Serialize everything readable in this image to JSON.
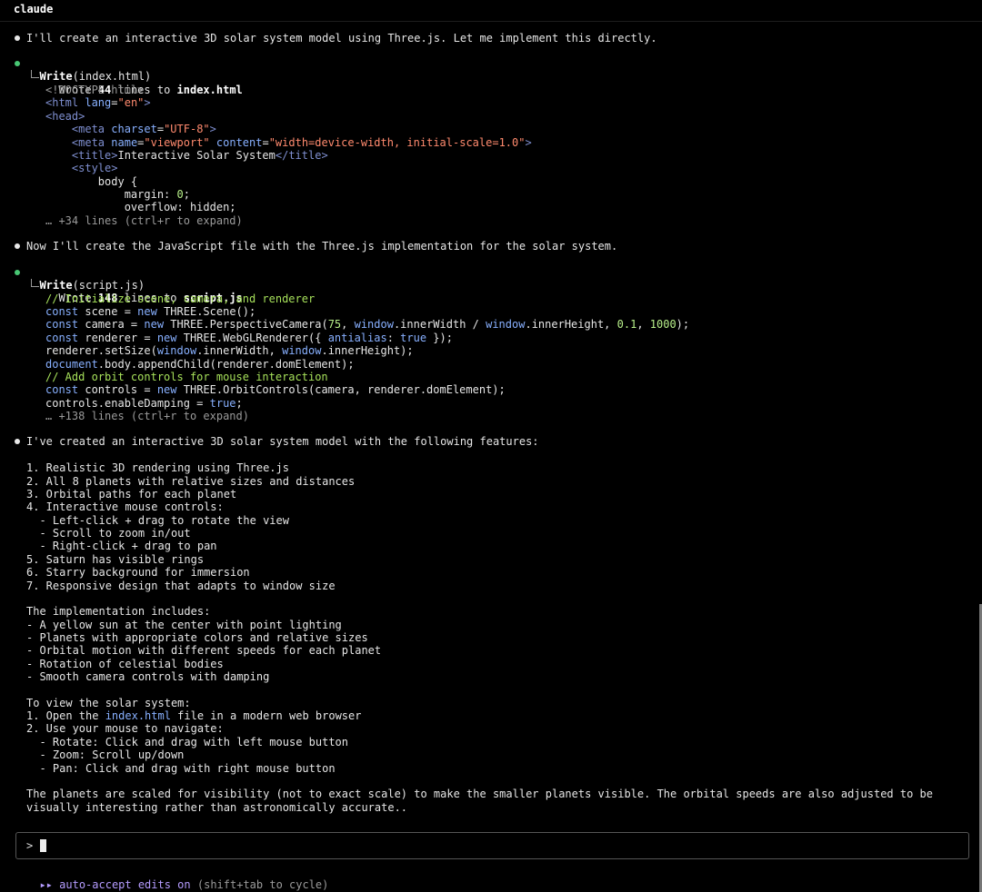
{
  "window": {
    "title": "claude"
  },
  "transcript": {
    "intro": "I'll create an interactive 3D solar system model using Three.js. Let me implement this directly.",
    "write1": {
      "tool": "Write",
      "arg": "(index.html)",
      "result_prefix": "Wrote ",
      "count": "44",
      "result_mid": " lines to ",
      "file": "index.html",
      "more": "… +34 lines (ctrl+r to expand)"
    },
    "mid_message": "Now I'll create the JavaScript file with the Three.js implementation for the solar system.",
    "write2": {
      "tool": "Write",
      "arg": "(script.js)",
      "result_prefix": "Wrote ",
      "count": "148",
      "result_mid": " lines to ",
      "file": "script.js",
      "more": "… +138 lines (ctrl+r to expand)"
    },
    "summary": {
      "lead": "I've created an interactive 3D solar system model with the following features:",
      "features": [
        "1. Realistic 3D rendering using Three.js",
        "2. All 8 planets with relative sizes and distances",
        "3. Orbital paths for each planet",
        "4. Interactive mouse controls:",
        "  - Left-click + drag to rotate the view",
        "  - Scroll to zoom in/out",
        "  - Right-click + drag to pan",
        "5. Saturn has visible rings",
        "6. Starry background for immersion",
        "7. Responsive design that adapts to window size"
      ],
      "impl_header": "The implementation includes:",
      "impl": [
        "- A yellow sun at the center with point lighting",
        "- Planets with appropriate colors and relative sizes",
        "- Orbital motion with different speeds for each planet",
        "- Rotation of celestial bodies",
        "- Smooth camera controls with damping"
      ],
      "view_header": "To view the solar system:",
      "view_step1_a": "1. Open the ",
      "view_step1_link": "index.html",
      "view_step1_b": " file in a modern web browser",
      "view_rest": [
        "2. Use your mouse to navigate:",
        "  - Rotate: Click and drag with left mouse button",
        "  - Zoom: Scroll up/down",
        "  - Pan: Click and drag with right mouse button"
      ],
      "closing_1": "The planets are scaled for visibility (not to exact scale) to make the smaller planets visible. The orbital speeds are also adjusted to be",
      "closing_2": "visually interesting rather than astronomically accurate.."
    }
  },
  "input": {
    "prompt_symbol": ">"
  },
  "status": {
    "arrows": "▸▸",
    "mode": "auto-accept edits on",
    "hint": "(shift+tab to cycle)"
  },
  "colors": {
    "background": "#000000",
    "bullet_tool": "#48c774",
    "status_accent": "#b59cff"
  }
}
